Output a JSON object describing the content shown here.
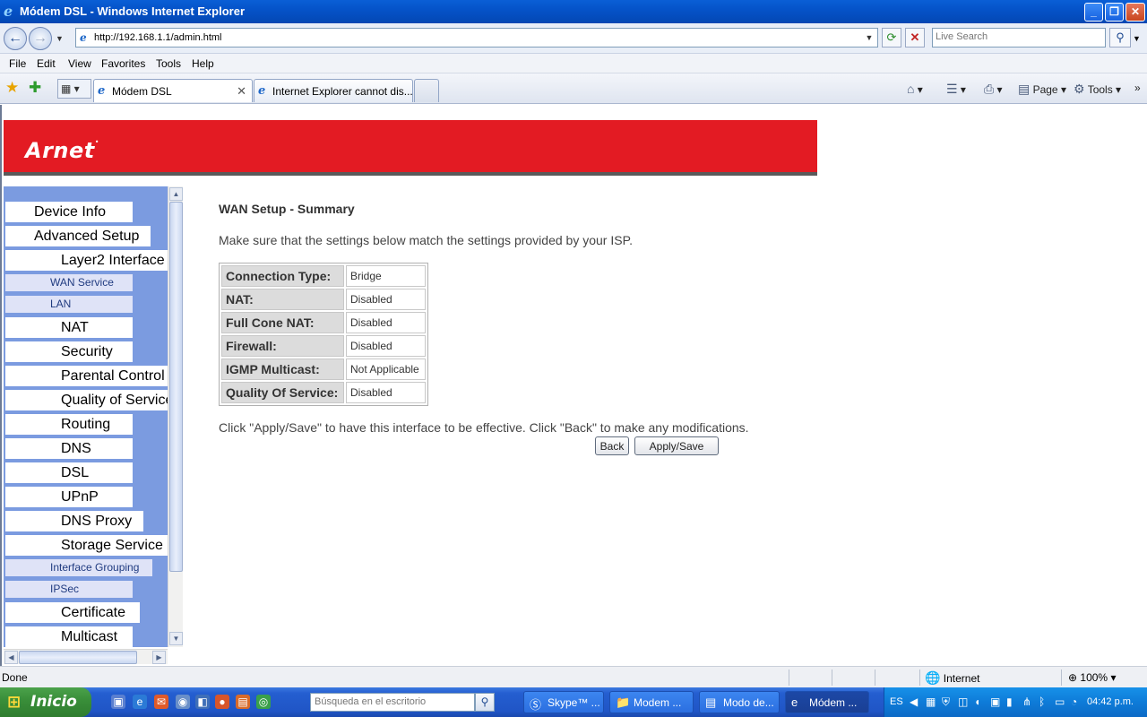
{
  "window": {
    "title": "Módem DSL - Windows Internet Explorer"
  },
  "browser": {
    "url": "http://192.168.1.1/admin.html",
    "search_placeholder": "Live Search",
    "menu": [
      "File",
      "Edit",
      "View",
      "Favorites",
      "Tools",
      "Help"
    ],
    "tabs": [
      {
        "label": "Módem DSL",
        "active": true
      },
      {
        "label": "Internet Explorer cannot dis...",
        "active": false
      }
    ],
    "commands": {
      "page": "Page",
      "tools": "Tools"
    }
  },
  "page": {
    "logo": "Arnet",
    "sidebar": [
      {
        "label": "Device Info",
        "style": "big"
      },
      {
        "label": "Advanced Setup",
        "style": "big"
      },
      {
        "label": "Layer2 Interface",
        "style": "big"
      },
      {
        "label": "WAN Service",
        "style": "small"
      },
      {
        "label": "LAN",
        "style": "small"
      },
      {
        "label": "NAT",
        "style": "big"
      },
      {
        "label": "Security",
        "style": "big"
      },
      {
        "label": "Parental Control",
        "style": "big"
      },
      {
        "label": "Quality of Service",
        "style": "big"
      },
      {
        "label": "Routing",
        "style": "big"
      },
      {
        "label": "DNS",
        "style": "big"
      },
      {
        "label": "DSL",
        "style": "big"
      },
      {
        "label": "UPnP",
        "style": "big"
      },
      {
        "label": "DNS Proxy",
        "style": "big"
      },
      {
        "label": "Storage Service",
        "style": "big"
      },
      {
        "label": "Interface Grouping",
        "style": "small"
      },
      {
        "label": "IPSec",
        "style": "small"
      },
      {
        "label": "Certificate",
        "style": "big"
      },
      {
        "label": "Multicast",
        "style": "big"
      }
    ],
    "heading": "WAN Setup - Summary",
    "note": "Make sure that the settings below match the settings provided by your ISP.",
    "summary": [
      {
        "label": "Connection Type:",
        "value": "Bridge"
      },
      {
        "label": "NAT:",
        "value": "Disabled"
      },
      {
        "label": "Full Cone NAT:",
        "value": "Disabled"
      },
      {
        "label": "Firewall:",
        "value": "Disabled"
      },
      {
        "label": "IGMP Multicast:",
        "value": "Not Applicable"
      },
      {
        "label": "Quality Of Service:",
        "value": "Disabled"
      }
    ],
    "help": "Click \"Apply/Save\" to have this interface to be effective. Click \"Back\" to make any modifications.",
    "buttons": {
      "back": "Back",
      "apply": "Apply/Save"
    }
  },
  "status": {
    "text": "Done",
    "zone": "Internet",
    "zoom": "100%"
  },
  "taskbar": {
    "start": "Inicio",
    "search_placeholder": "Búsqueda en el escritorio",
    "tasks": [
      {
        "label": "Skype™ ...",
        "active": false
      },
      {
        "label": "Modem ...",
        "active": false
      },
      {
        "label": "Modo de...",
        "active": false
      },
      {
        "label": "Módem ...",
        "active": true
      }
    ],
    "lang": "ES",
    "clock": "04:42 p.m."
  },
  "colors": {
    "banner": "#e31b23",
    "sidebar": "#7b9be0",
    "xp_blue": "#245ed0",
    "start_green": "#3a8f3a"
  }
}
